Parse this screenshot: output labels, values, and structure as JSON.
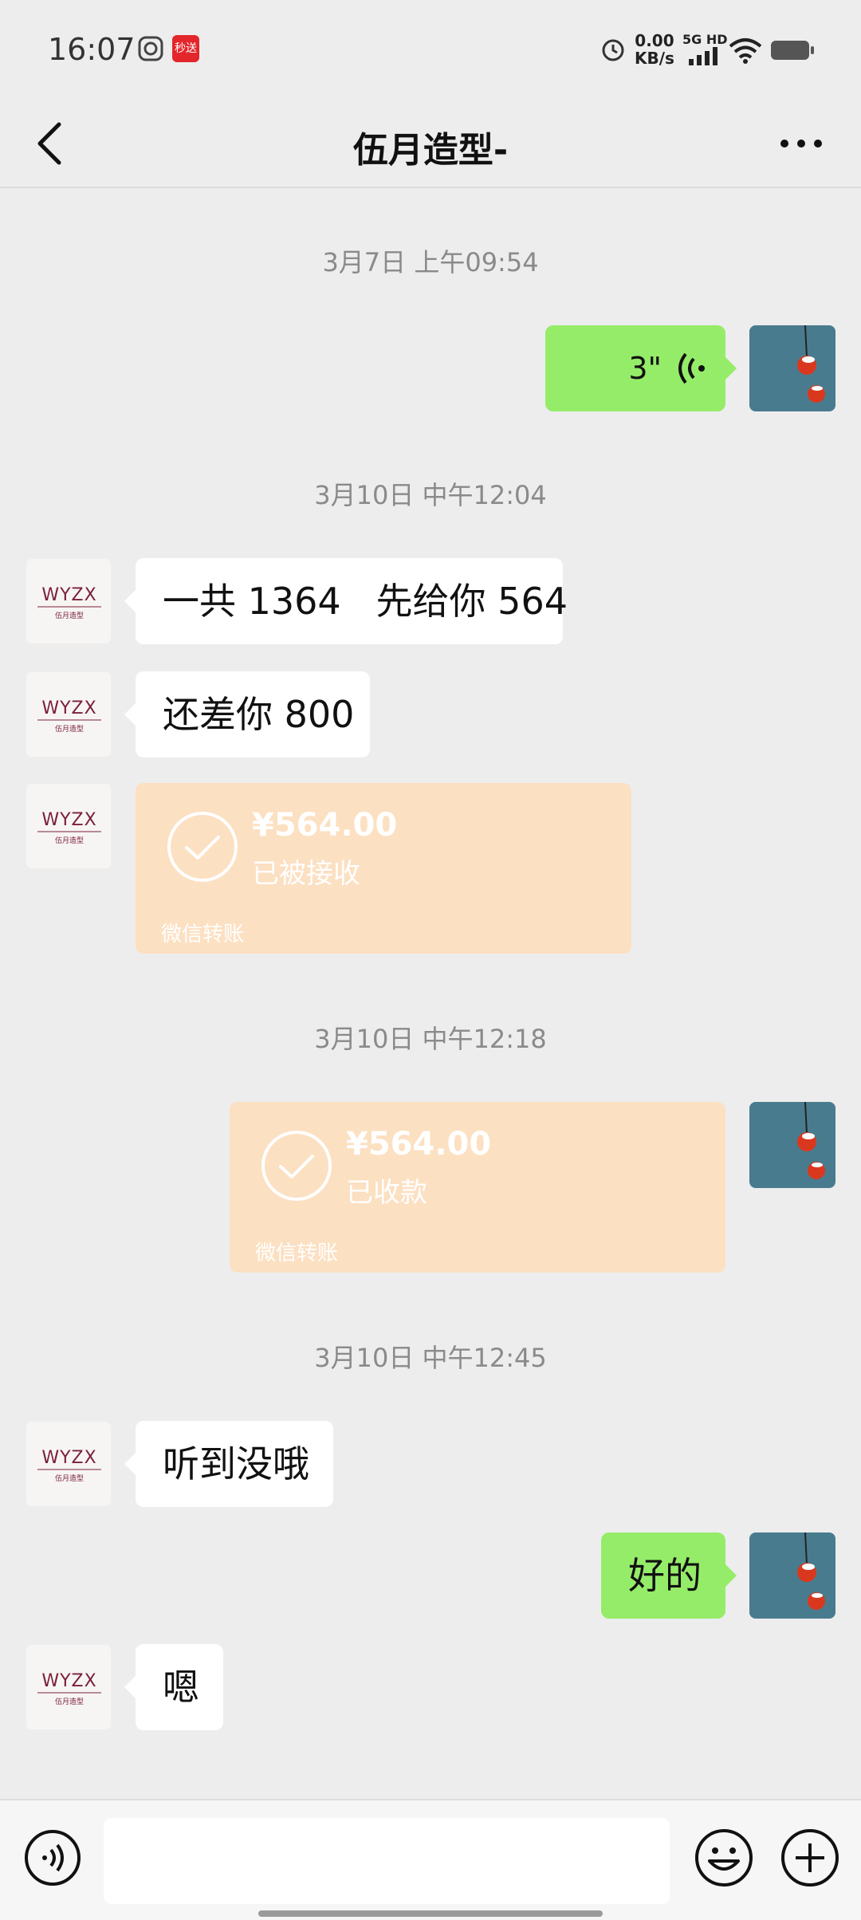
{
  "status_bar": {
    "time": "16:07",
    "app_badge": "秒送",
    "net_speed_value": "0.00",
    "net_speed_unit": "KB/s",
    "network_type": "5G HD",
    "icons": [
      "notification-icon",
      "app-badge-icon",
      "alarm-icon",
      "signal-icon",
      "wifi-icon",
      "battery-icon"
    ]
  },
  "header": {
    "title": "伍月造型-",
    "back_icon": "chevron-left-icon",
    "more_icon": "more-dots-icon"
  },
  "contact": {
    "avatar_brand_text": "WYZX",
    "avatar_brand_subtext": "伍月造型"
  },
  "messages": {
    "ts1": "3月7日 上午09:54",
    "voice_duration": "3\"",
    "ts2": "3月10日 中午12:04",
    "text1": "一共 1364   先给你 564",
    "text2": "还差你 800",
    "transfer1": {
      "amount": "¥564.00",
      "status": "已被接收",
      "footer": "微信转账"
    },
    "ts3": "3月10日 中午12:18",
    "transfer2": {
      "amount": "¥564.00",
      "status": "已收款",
      "footer": "微信转账"
    },
    "ts4": "3月10日 中午12:45",
    "text3": "听到没哦",
    "text4": "好的",
    "text5": "嗯"
  },
  "input_bar": {
    "placeholder": "",
    "icons": [
      "voice-toggle-icon",
      "emoji-icon",
      "plus-icon"
    ]
  },
  "colors": {
    "background": "#ededed",
    "outgoing_bubble": "#95ec69",
    "incoming_bubble": "#ffffff",
    "transfer_card": "#fce0c2",
    "brand_maroon": "#7a1f3a"
  }
}
